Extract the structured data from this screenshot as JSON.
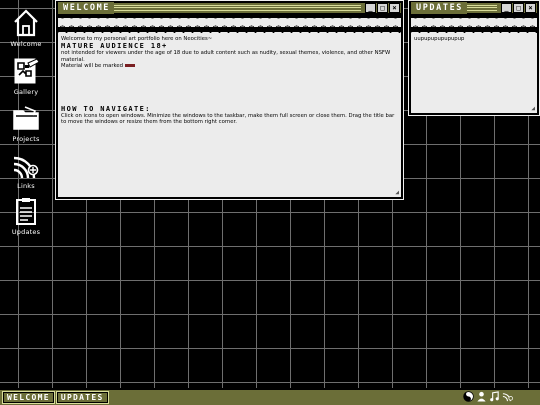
{
  "desktop": {
    "icons": [
      {
        "label": "Welcome",
        "icon": "house-icon"
      },
      {
        "label": "Gallery",
        "icon": "gallery-icon"
      },
      {
        "label": "Projects",
        "icon": "folder-icon"
      },
      {
        "label": "Links",
        "icon": "wifi-icon"
      },
      {
        "label": "Updates",
        "icon": "clipboard-icon"
      }
    ]
  },
  "welcome_window": {
    "title": "WELCOME",
    "controls": [
      "_",
      "□",
      "×"
    ],
    "intro": "Welcome to my personal art portfolio here on Neocities~",
    "section1": {
      "heading": "MATURE AUDIENCE 18+",
      "lines": [
        "not intended for viewers under the age of 18 due to adult content such as nudity, sexual themes, violence, and other NSFW material.",
        "Material will be marked"
      ]
    },
    "section2": {
      "heading": "HOW TO NAVIGATE:",
      "body": "Click on icons to open windows. Minimize the windows to the taskbar, make them full screen or close them. Drag the title bar to move the windows or resize them from the bottom right corner."
    }
  },
  "updates_window": {
    "title": "UPDATES",
    "controls": [
      "_",
      "□",
      "×"
    ],
    "body": "uupupupupupupup"
  },
  "taskbar": {
    "tasks": [
      "WELCOME",
      "UPDATES"
    ],
    "tray_icons": [
      "yin-yang-icon",
      "user-icon",
      "music-icon",
      "wifi-icon"
    ]
  },
  "colors": {
    "accent_olive": "#6b6e38",
    "accent_light": "#d8dc9a",
    "window_bg": "#ececec",
    "marker_red": "#7a1f22",
    "grid_line": "#6e6e6e"
  }
}
